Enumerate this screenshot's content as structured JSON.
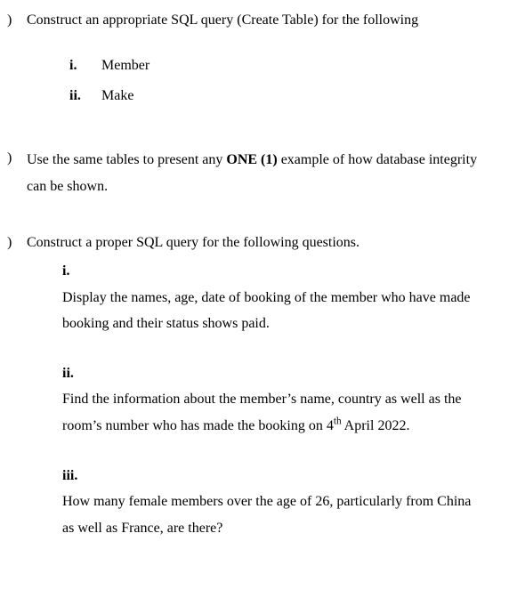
{
  "qa": {
    "marker": ")",
    "text": "Construct an appropriate SQL query (Create Table) for the following",
    "items": [
      {
        "roman": "i.",
        "text": "Member"
      },
      {
        "roman": "ii.",
        "text": "Make"
      }
    ]
  },
  "qb": {
    "marker": ")",
    "text_pre": "Use the same tables to present any ",
    "text_bold": "ONE (1)",
    "text_post": " example of how database integrity can be shown."
  },
  "qc": {
    "marker": ")",
    "text": "Construct a proper SQL query for the following questions.",
    "items": [
      {
        "roman": "i.",
        "text": "Display the names, age, date of booking of the member who have made booking and their status shows paid."
      },
      {
        "roman": "ii.",
        "text_pre": "Find the information about the member’s name, country as well as the room’s number who has made the booking on 4",
        "sup": "th",
        "text_post": " April 2022."
      },
      {
        "roman": "iii.",
        "text": "How many female members over the age of 26, particularly from China as well as France, are there?"
      }
    ]
  }
}
